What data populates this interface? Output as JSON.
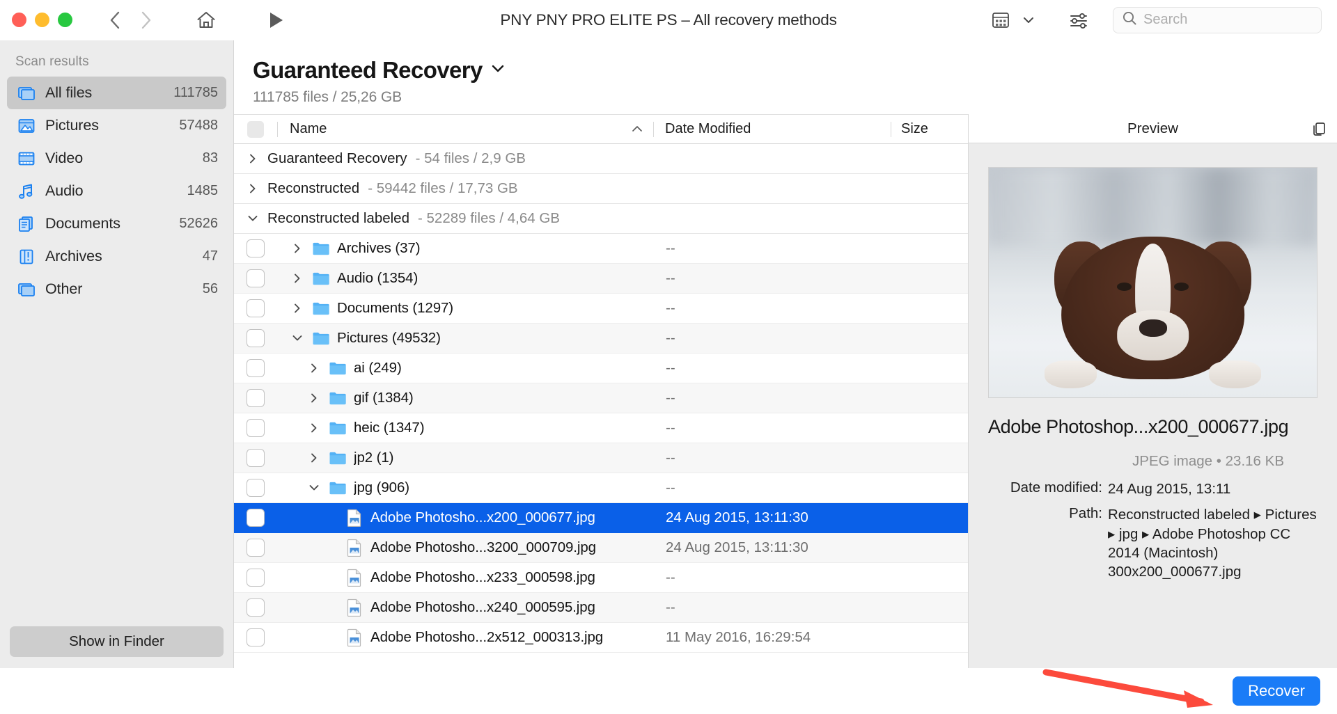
{
  "window": {
    "title": "PNY PNY PRO ELITE PS – All recovery methods",
    "traffic_colors": {
      "close": "#ff5f57",
      "minimize": "#febc2e",
      "zoom": "#28c840"
    }
  },
  "toolbar": {
    "back_icon": "chevron-left-icon",
    "forward_icon": "chevron-right-icon",
    "home_icon": "home-icon",
    "play_icon": "play-icon",
    "view_mode_icon": "grid-view-icon",
    "view_mode_chevron": "chevron-down-icon",
    "filter_icon": "sliders-icon",
    "search_icon": "search-icon"
  },
  "search": {
    "value": "",
    "placeholder": "Search"
  },
  "sidebar": {
    "header": "Scan results",
    "items": [
      {
        "label": "All files",
        "count": "111785",
        "icon": "all-files-icon",
        "active": true
      },
      {
        "label": "Pictures",
        "count": "57488",
        "icon": "pictures-icon",
        "active": false
      },
      {
        "label": "Video",
        "count": "83",
        "icon": "video-icon",
        "active": false
      },
      {
        "label": "Audio",
        "count": "1485",
        "icon": "audio-icon",
        "active": false
      },
      {
        "label": "Documents",
        "count": "52626",
        "icon": "documents-icon",
        "active": false
      },
      {
        "label": "Archives",
        "count": "47",
        "icon": "archives-icon",
        "active": false
      },
      {
        "label": "Other",
        "count": "56",
        "icon": "other-icon",
        "active": false
      }
    ],
    "footer_button": "Show in Finder"
  },
  "main": {
    "title": "Guaranteed Recovery",
    "title_chevron": "chevron-down-icon",
    "subtitle": "111785 files / 25,26 GB"
  },
  "table": {
    "columns": {
      "name": "Name",
      "date": "Date Modified",
      "size": "Size"
    },
    "sort_indicator": "chevron-up-icon",
    "groups": [
      {
        "name": "Guaranteed Recovery",
        "meta": "- 54 files / 2,9 GB",
        "expanded": false
      },
      {
        "name": "Reconstructed",
        "meta": "- 59442 files / 17,73 GB",
        "expanded": false
      },
      {
        "name": "Reconstructed labeled",
        "meta": "- 52289 files / 4,64 GB",
        "expanded": true
      }
    ],
    "rows": [
      {
        "label": "Archives (37)",
        "date": "--",
        "size": "",
        "type": "folder",
        "depth": 1,
        "expanded": false,
        "selected": false,
        "alt": false
      },
      {
        "label": "Audio (1354)",
        "date": "--",
        "size": "",
        "type": "folder",
        "depth": 1,
        "expanded": false,
        "selected": false,
        "alt": true
      },
      {
        "label": "Documents (1297)",
        "date": "--",
        "size": "",
        "type": "folder",
        "depth": 1,
        "expanded": false,
        "selected": false,
        "alt": false
      },
      {
        "label": "Pictures (49532)",
        "date": "--",
        "size": "",
        "type": "folder",
        "depth": 1,
        "expanded": true,
        "selected": false,
        "alt": true
      },
      {
        "label": "ai (249)",
        "date": "--",
        "size": "",
        "type": "folder",
        "depth": 2,
        "expanded": false,
        "selected": false,
        "alt": false
      },
      {
        "label": "gif (1384)",
        "date": "--",
        "size": "",
        "type": "folder",
        "depth": 2,
        "expanded": false,
        "selected": false,
        "alt": true
      },
      {
        "label": "heic (1347)",
        "date": "--",
        "size": "",
        "type": "folder",
        "depth": 2,
        "expanded": false,
        "selected": false,
        "alt": false
      },
      {
        "label": "jp2 (1)",
        "date": "--",
        "size": "",
        "type": "folder",
        "depth": 2,
        "expanded": false,
        "selected": false,
        "alt": true
      },
      {
        "label": "jpg (906)",
        "date": "--",
        "size": "",
        "type": "folder",
        "depth": 2,
        "expanded": true,
        "selected": false,
        "alt": false
      },
      {
        "label": "Adobe Photosho...x200_000677.jpg",
        "date": "24 Aug 2015, 13:11:30",
        "size": "",
        "type": "file",
        "depth": 3,
        "expanded": null,
        "selected": true,
        "alt": false
      },
      {
        "label": "Adobe Photosho...3200_000709.jpg",
        "date": "24 Aug 2015, 13:11:30",
        "size": "",
        "type": "file",
        "depth": 3,
        "expanded": null,
        "selected": false,
        "alt": true
      },
      {
        "label": "Adobe Photosho...x233_000598.jpg",
        "date": "--",
        "size": "",
        "type": "file",
        "depth": 3,
        "expanded": null,
        "selected": false,
        "alt": false
      },
      {
        "label": "Adobe Photosho...x240_000595.jpg",
        "date": "--",
        "size": "",
        "type": "file",
        "depth": 3,
        "expanded": null,
        "selected": false,
        "alt": true
      },
      {
        "label": "Adobe Photosho...2x512_000313.jpg",
        "date": "11 May 2016, 16:29:54",
        "size": "",
        "type": "file",
        "depth": 3,
        "expanded": null,
        "selected": false,
        "alt": false
      }
    ]
  },
  "preview": {
    "header": "Preview",
    "copy_icon": "copy-icon",
    "filename": "Adobe Photoshop...x200_000677.jpg",
    "type_line": "JPEG image • 23.16 KB",
    "date_label": "Date modified:",
    "date_value": "24 Aug 2015, 13:11",
    "path_label": "Path:",
    "path_value": "Reconstructed labeled ▸ Pictures ▸ jpg ▸ Adobe Photoshop CC 2014 (Macintosh) 300x200_000677.jpg"
  },
  "bottom": {
    "recover_label": "Recover",
    "recover_color": "#1a7cf7",
    "annotation_arrow_color": "#fc4a3c"
  }
}
